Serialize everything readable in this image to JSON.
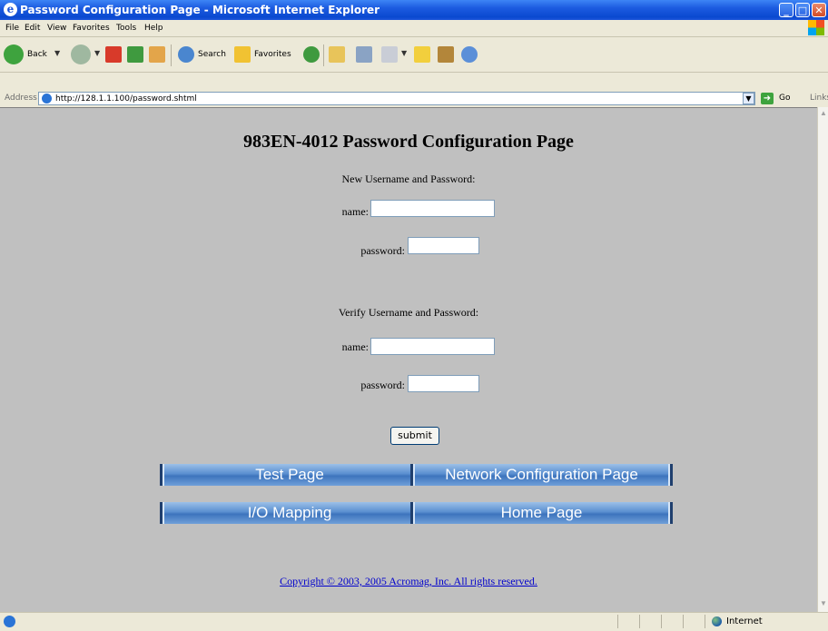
{
  "window": {
    "title": "Password Configuration Page - Microsoft Internet Explorer"
  },
  "menu": [
    "File",
    "Edit",
    "View",
    "Favorites",
    "Tools",
    "Help"
  ],
  "toolbar": {
    "back_label": "Back",
    "search_label": "Search",
    "favorites_label": "Favorites"
  },
  "address": {
    "label": "Address",
    "url": "http://128.1.1.100/password.shtml",
    "go_label": "Go",
    "links_label": "Links"
  },
  "page": {
    "title": "983EN-4012 Password Configuration Page",
    "new_section_label": "New Username and Password:",
    "verify_section_label": "Verify Username and Password:",
    "name_label": "name:",
    "password_label": "password:",
    "new_name_value": "",
    "new_password_value": "",
    "verify_name_value": "",
    "verify_password_value": "",
    "submit_label": "submit",
    "nav": {
      "test_page": "Test Page",
      "network_config": "Network Configuration Page",
      "io_mapping": "I/O Mapping",
      "home_page": "Home Page"
    },
    "copyright": "Copyright © 2003, 2005 Acromag, Inc. All rights reserved."
  },
  "status": {
    "zone": "Internet"
  },
  "colors": {
    "titlebar": "#0a49d0",
    "content_background": "#c0c0c0",
    "nav_button": "#5a8fd0",
    "link": "#0000cc"
  }
}
